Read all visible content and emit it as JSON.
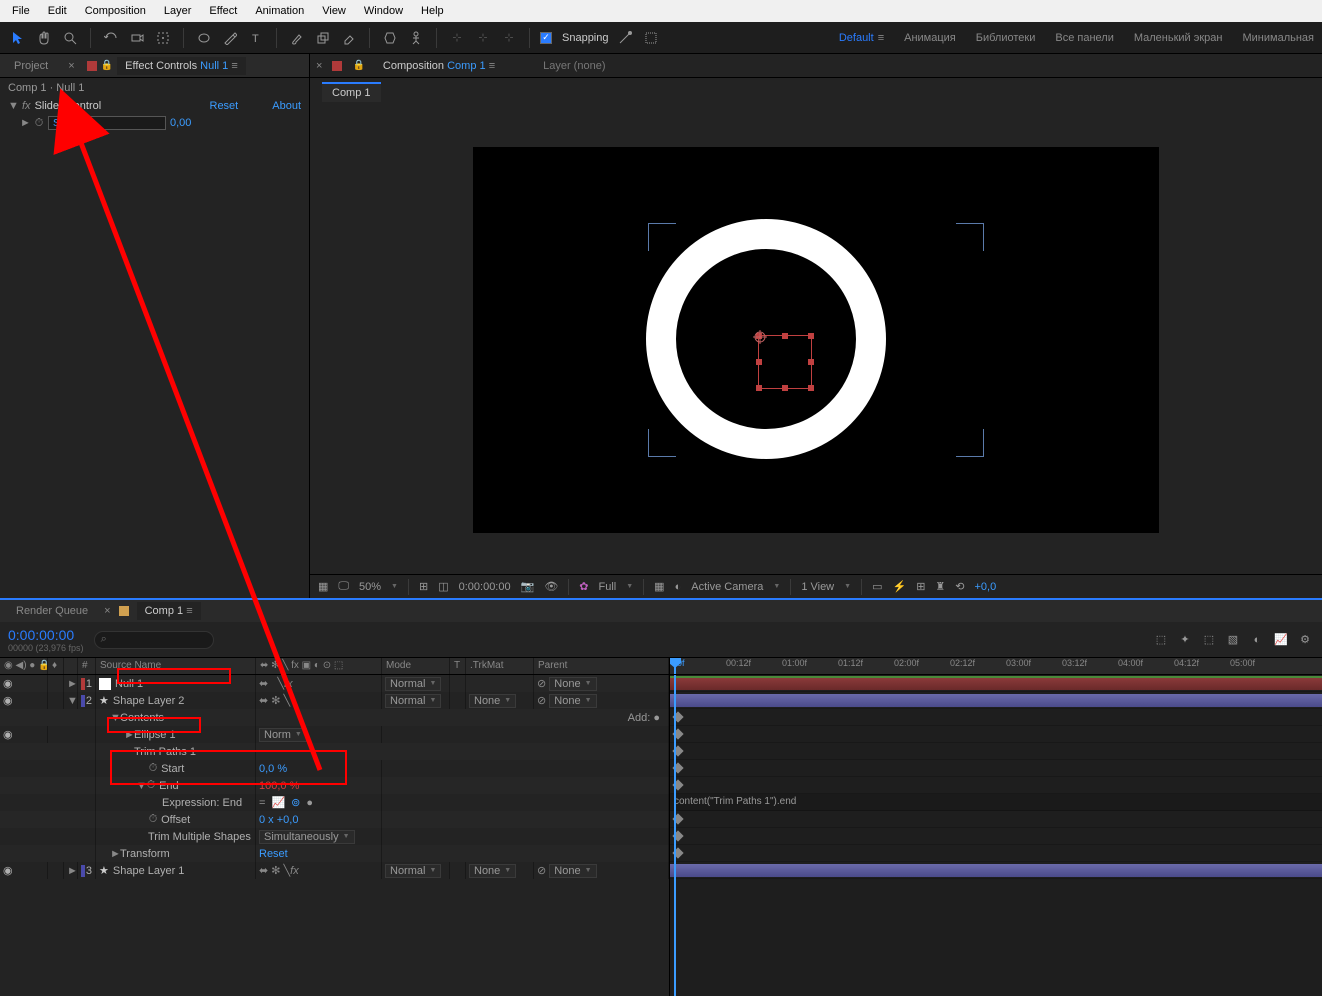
{
  "menu": [
    "File",
    "Edit",
    "Composition",
    "Layer",
    "Effect",
    "Animation",
    "View",
    "Window",
    "Help"
  ],
  "toolbar": {
    "snapping": "Snapping"
  },
  "workspaces": [
    "Default",
    "Анимация",
    "Библиотеки",
    "Все панели",
    "Маленький экран",
    "Минимальная"
  ],
  "leftPanel": {
    "tabs": {
      "project": "Project",
      "effectControls": "Effect Controls",
      "target": "Null 1"
    },
    "breadcrumb": "Comp 1 · Null 1",
    "effect": {
      "name": "Slider Control",
      "reset": "Reset",
      "about": "About"
    },
    "prop": {
      "name": "Slider",
      "value": "0,00"
    }
  },
  "compPanel": {
    "tab": "Composition",
    "compName": "Comp 1",
    "layerLabel": "Layer (none)",
    "subTab": "Comp 1"
  },
  "viewerFooter": {
    "zoom": "50%",
    "timecode": "0:00:00:00",
    "channels": "Full",
    "camera": "Active Camera",
    "views": "1 View",
    "exposure": "+0,0"
  },
  "timeline": {
    "tabs": {
      "renderQueue": "Render Queue",
      "comp": "Comp 1"
    },
    "timecode": "0:00:00:00",
    "timecodeSub": "00000 (23,976 fps)",
    "searchPlaceholder": "⌕",
    "columns": {
      "num": "#",
      "source": "Source Name",
      "mode": "Mode",
      "t": "T",
      "trkmat": ".TrkMat",
      "parent": "Parent"
    },
    "ruler": [
      "00f",
      "00:12f",
      "01:00f",
      "01:12f",
      "02:00f",
      "02:12f",
      "03:00f",
      "03:12f",
      "04:00f",
      "04:12f",
      "05:00f"
    ],
    "layers": [
      {
        "num": "1",
        "name": "Null 1",
        "color": "#fff",
        "mode": "Normal",
        "trkmat": "",
        "parent": "None",
        "bar": "red",
        "icon": "null"
      },
      {
        "num": "2",
        "name": "Shape Layer 2",
        "color": "#4a4aaa",
        "mode": "Normal",
        "trkmat": "None",
        "parent": "None",
        "bar": "blue",
        "icon": "star",
        "highlight": true
      }
    ],
    "props": [
      {
        "indent": 1,
        "twirl": "▼",
        "label": "Contents",
        "extra": "Add: ●"
      },
      {
        "indent": 2,
        "twirl": "►",
        "label": "Ellipse 1",
        "mode": "Norm"
      },
      {
        "indent": 2,
        "twirl": "",
        "label": "Trim Paths 1",
        "highlight": true
      },
      {
        "indent": 3,
        "stopwatch": true,
        "label": "Start",
        "value": "0,0 %"
      },
      {
        "indent": 3,
        "twirl": "▼",
        "stopwatch": true,
        "label": "End",
        "value": "100,0 %",
        "red": true,
        "hlRow": true
      },
      {
        "indent": 4,
        "label": "Expression: End",
        "exprIcons": true,
        "hlRow": true
      },
      {
        "indent": 3,
        "stopwatch": true,
        "label": "Offset",
        "value": "0 x +0,0"
      },
      {
        "indent": 3,
        "label": "Trim Multiple Shapes",
        "select": "Simultaneously"
      },
      {
        "indent": 1,
        "twirl": "►",
        "label": "Transform",
        "value": "Reset",
        "linkVal": true
      }
    ],
    "layer3": {
      "num": "3",
      "name": "Shape Layer 1",
      "color": "#4a4aaa",
      "mode": "Normal",
      "trkmat": "None",
      "parent": "None"
    },
    "exprText": "content(\"Trim Paths 1\").end"
  }
}
